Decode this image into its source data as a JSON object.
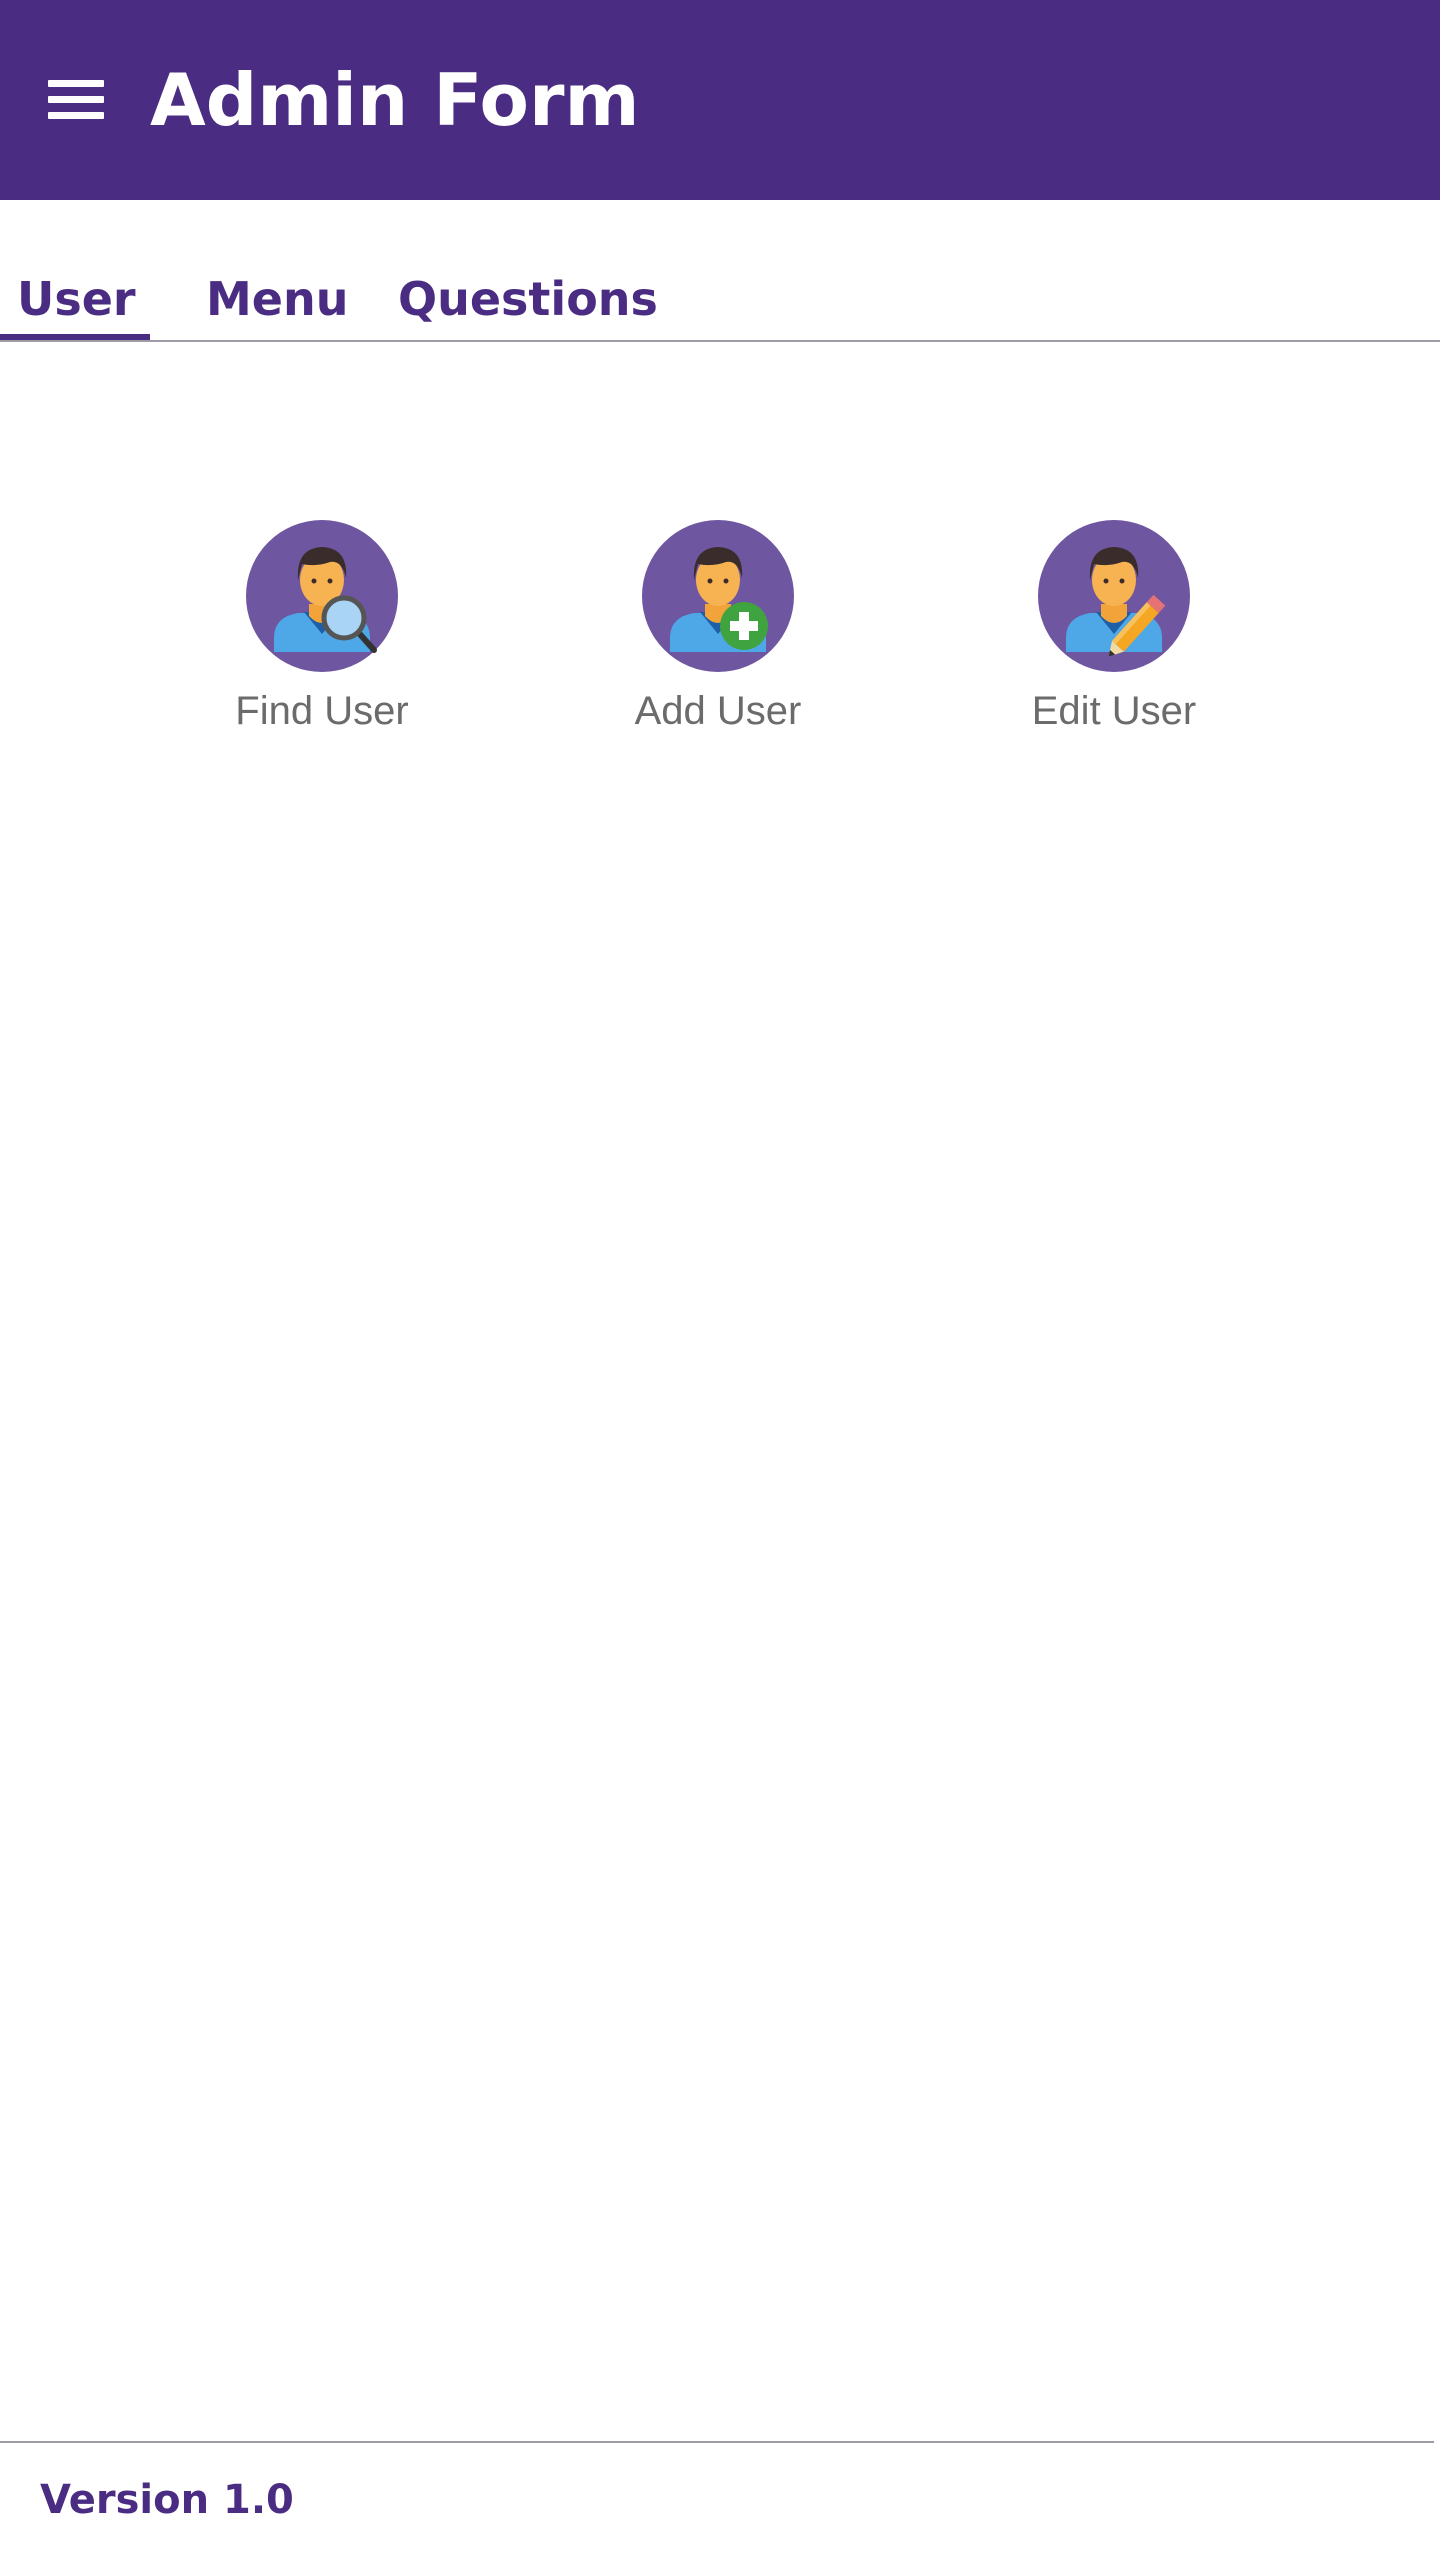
{
  "app_bar": {
    "title": "Admin Form",
    "menu_icon": "hamburger-menu-icon",
    "background": "#4a2d82"
  },
  "tabs": {
    "items": [
      {
        "label": "User",
        "active": true
      },
      {
        "label": "Menu",
        "active": false
      },
      {
        "label": "Questions",
        "active": false
      }
    ],
    "accent": "#4a2d82"
  },
  "actions": [
    {
      "label": "Find User",
      "icon": "find-user-icon"
    },
    {
      "label": "Add User",
      "icon": "add-user-icon"
    },
    {
      "label": "Edit User",
      "icon": "edit-user-icon"
    }
  ],
  "footer": {
    "version": "Version 1.0"
  },
  "colors": {
    "icon_circle": "#6f56a1",
    "label_text": "#6b6b6b"
  }
}
